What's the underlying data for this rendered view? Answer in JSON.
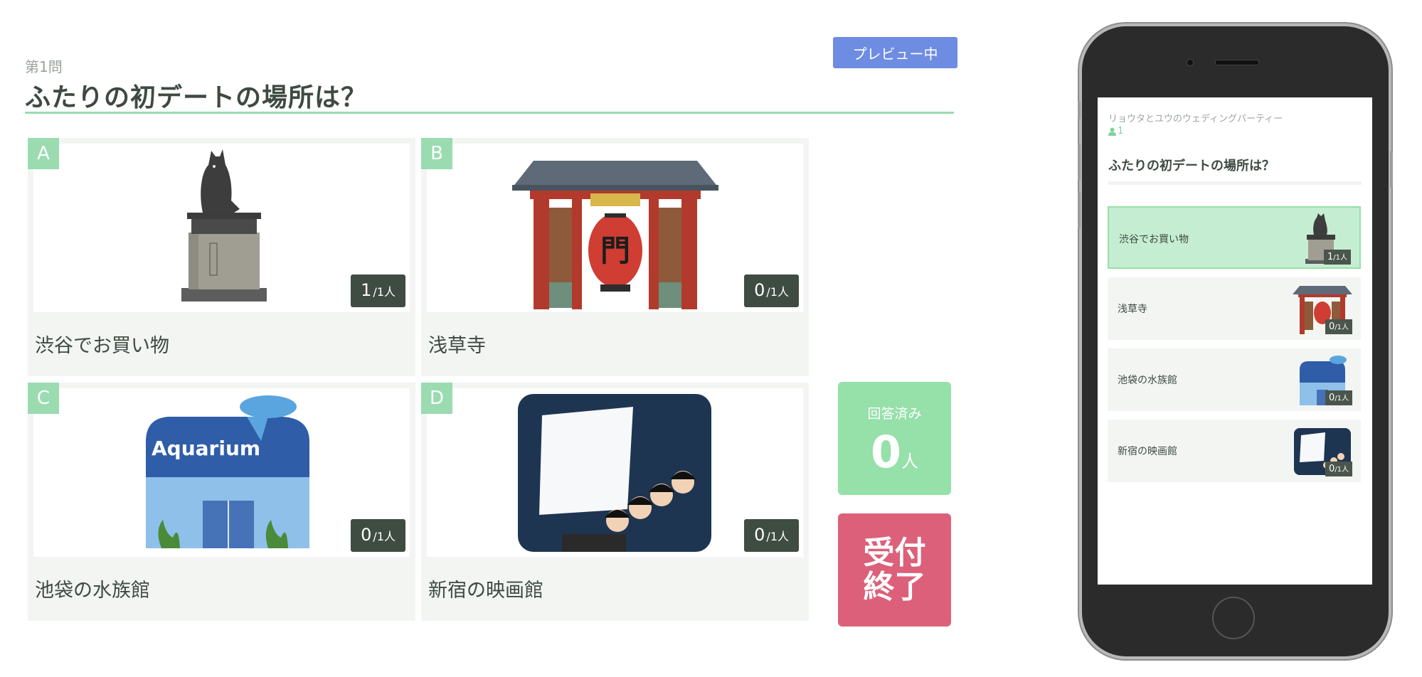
{
  "question": {
    "number_label": "第1問",
    "title": "ふたりの初デートの場所は？"
  },
  "preview_button": "プレビュー中",
  "choices": [
    {
      "letter": "A",
      "label": "渋谷でお買い物",
      "count": "1",
      "total": "/1人",
      "image": "hachiko-statue"
    },
    {
      "letter": "B",
      "label": "浅草寺",
      "count": "0",
      "total": "/1人",
      "image": "kaminarimon-gate"
    },
    {
      "letter": "C",
      "label": "池袋の水族館",
      "count": "0",
      "total": "/1人",
      "image": "aquarium-building",
      "image_text": "Aquarium"
    },
    {
      "letter": "D",
      "label": "新宿の映画館",
      "count": "0",
      "total": "/1人",
      "image": "movie-theater"
    }
  ],
  "answered": {
    "title": "回答済み",
    "value": "0",
    "unit": "人"
  },
  "close_button": {
    "line1": "受付",
    "line2": "終了"
  },
  "phone": {
    "party_name": "リョウタとユウのウェディングパーティー",
    "user_count": "1",
    "title": "ふたりの初デートの場所は？",
    "items": [
      {
        "label": "渋谷でお買い物",
        "count": "1",
        "total": "/1人",
        "selected": true
      },
      {
        "label": "浅草寺",
        "count": "0",
        "total": "/1人",
        "selected": false
      },
      {
        "label": "池袋の水族館",
        "count": "0",
        "total": "/1人",
        "selected": false
      },
      {
        "label": "新宿の映画館",
        "count": "0",
        "total": "/1人",
        "selected": false
      }
    ]
  },
  "colors": {
    "accent_green": "#9adbb0",
    "preview_blue": "#6f8ce3",
    "close_red": "#dc6079",
    "count_badge": "#3f4c42"
  }
}
